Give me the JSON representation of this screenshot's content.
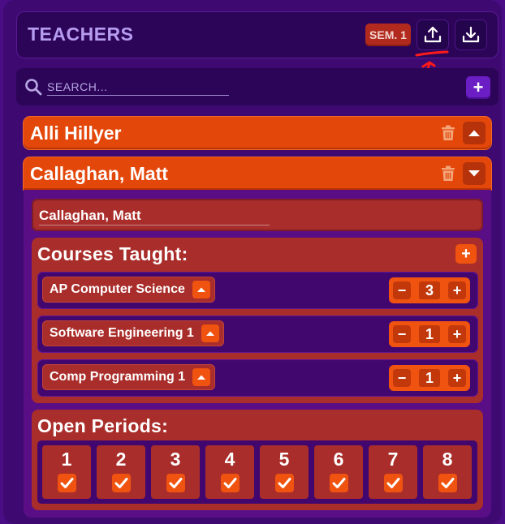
{
  "header": {
    "title": "TEACHERS",
    "semester_badge": "SEM. 1",
    "upload_icon": "upload-icon",
    "download_icon": "download-icon"
  },
  "search": {
    "placeholder": "SEARCH...",
    "value": "",
    "add_label": "+"
  },
  "teachers": [
    {
      "name": "Alli Hillyer",
      "expanded": false
    },
    {
      "name": "Callaghan, Matt",
      "expanded": true
    }
  ],
  "detail": {
    "name_value": "Callaghan, Matt",
    "courses_title": "Courses Taught:",
    "add_course_label": "+",
    "courses": [
      {
        "name": "AP Computer Science",
        "count": "3"
      },
      {
        "name": "Software Engineering 1",
        "count": "1"
      },
      {
        "name": "Comp Programming 1",
        "count": "1"
      }
    ],
    "stepper": {
      "minus": "−",
      "plus": "+"
    },
    "periods_title": "Open Periods:",
    "periods": [
      {
        "number": "1",
        "checked": true
      },
      {
        "number": "2",
        "checked": true
      },
      {
        "number": "3",
        "checked": true
      },
      {
        "number": "4",
        "checked": true
      },
      {
        "number": "5",
        "checked": true
      },
      {
        "number": "6",
        "checked": true
      },
      {
        "number": "7",
        "checked": true
      },
      {
        "number": "8",
        "checked": true
      }
    ]
  },
  "colors": {
    "accent": "#e4470a",
    "background": "#3e0a72",
    "panel": "#a92d2a",
    "title": "#b69cf0"
  }
}
